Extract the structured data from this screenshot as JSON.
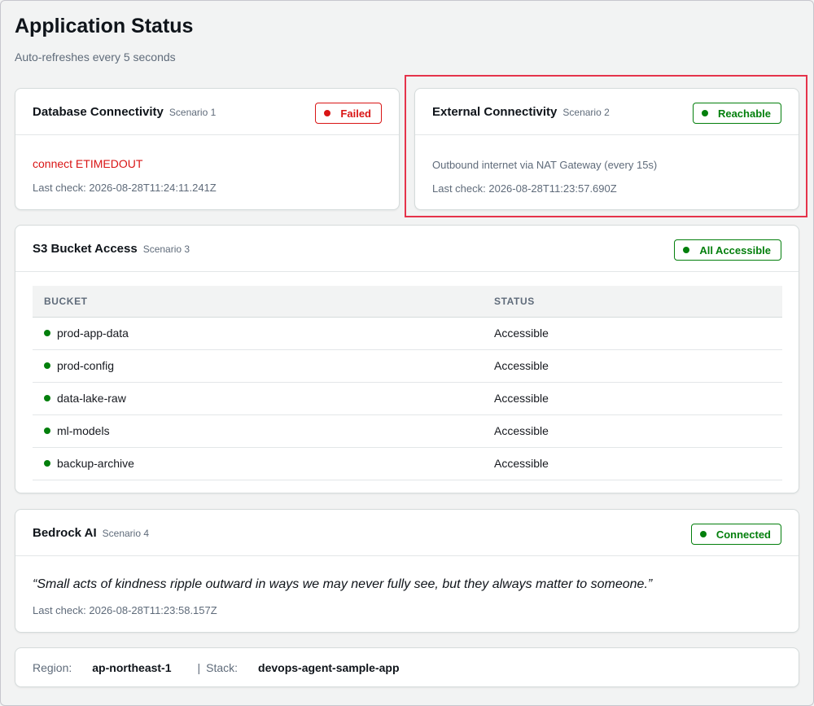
{
  "page": {
    "title": "Application Status",
    "subtitle": "Auto-refreshes every 5 seconds"
  },
  "database": {
    "title": "Database Connectivity",
    "scenario": "Scenario 1",
    "badge": "Failed",
    "error": "connect ETIMEDOUT",
    "last_check": "Last check: 2026-08-28T11:24:11.241Z"
  },
  "external": {
    "title": "External Connectivity",
    "scenario": "Scenario 2",
    "badge": "Reachable",
    "description": "Outbound internet via NAT Gateway (every 15s)",
    "last_check": "Last check: 2026-08-28T11:23:57.690Z"
  },
  "s3": {
    "title": "S3 Bucket Access",
    "scenario": "Scenario 3",
    "badge": "All Accessible",
    "columns": [
      "BUCKET",
      "STATUS"
    ],
    "rows": [
      {
        "bucket": "prod-app-data",
        "status": "Accessible"
      },
      {
        "bucket": "prod-config",
        "status": "Accessible"
      },
      {
        "bucket": "data-lake-raw",
        "status": "Accessible"
      },
      {
        "bucket": "ml-models",
        "status": "Accessible"
      },
      {
        "bucket": "backup-archive",
        "status": "Accessible"
      }
    ]
  },
  "bedrock": {
    "title": "Bedrock AI",
    "scenario": "Scenario 4",
    "badge": "Connected",
    "quote": "“Small acts of kindness ripple outward in ways we may never fully see, but they always matter to someone.”",
    "last_check": "Last check: 2026-08-28T11:23:58.157Z"
  },
  "footer": {
    "region_label": "Region:",
    "region_value": "ap-northeast-1",
    "stack_label": "Stack:",
    "stack_value": "devops-agent-sample-app",
    "separator": "|"
  },
  "colors": {
    "success": "#037f0c",
    "error": "#d91515",
    "highlight": "#e5334b"
  }
}
